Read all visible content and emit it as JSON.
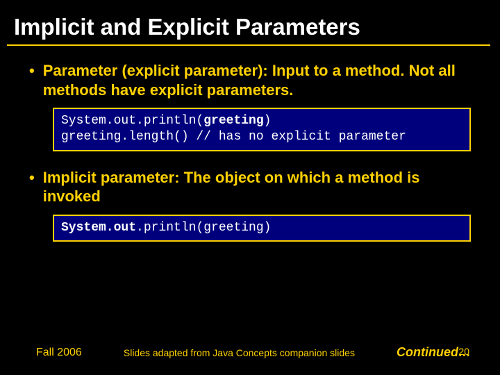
{
  "title": "Implicit and Explicit Parameters",
  "bullets": {
    "b1_text": "Parameter (explicit parameter): Input to a method. Not all methods have explicit parameters.",
    "b2_text": "Implicit parameter: The object on which a method is invoked"
  },
  "code1": {
    "l1a": "System.out.println(",
    "l1b": "greeting",
    "l1c": ")",
    "l2": "greeting.length() // has no explicit parameter"
  },
  "code2": {
    "l1a": "System.out",
    "l1b": ".println(greeting)"
  },
  "footer": {
    "left": "Fall 2006",
    "center": "Slides adapted from Java Concepts companion slides",
    "right": "Continued…",
    "page": "20"
  }
}
